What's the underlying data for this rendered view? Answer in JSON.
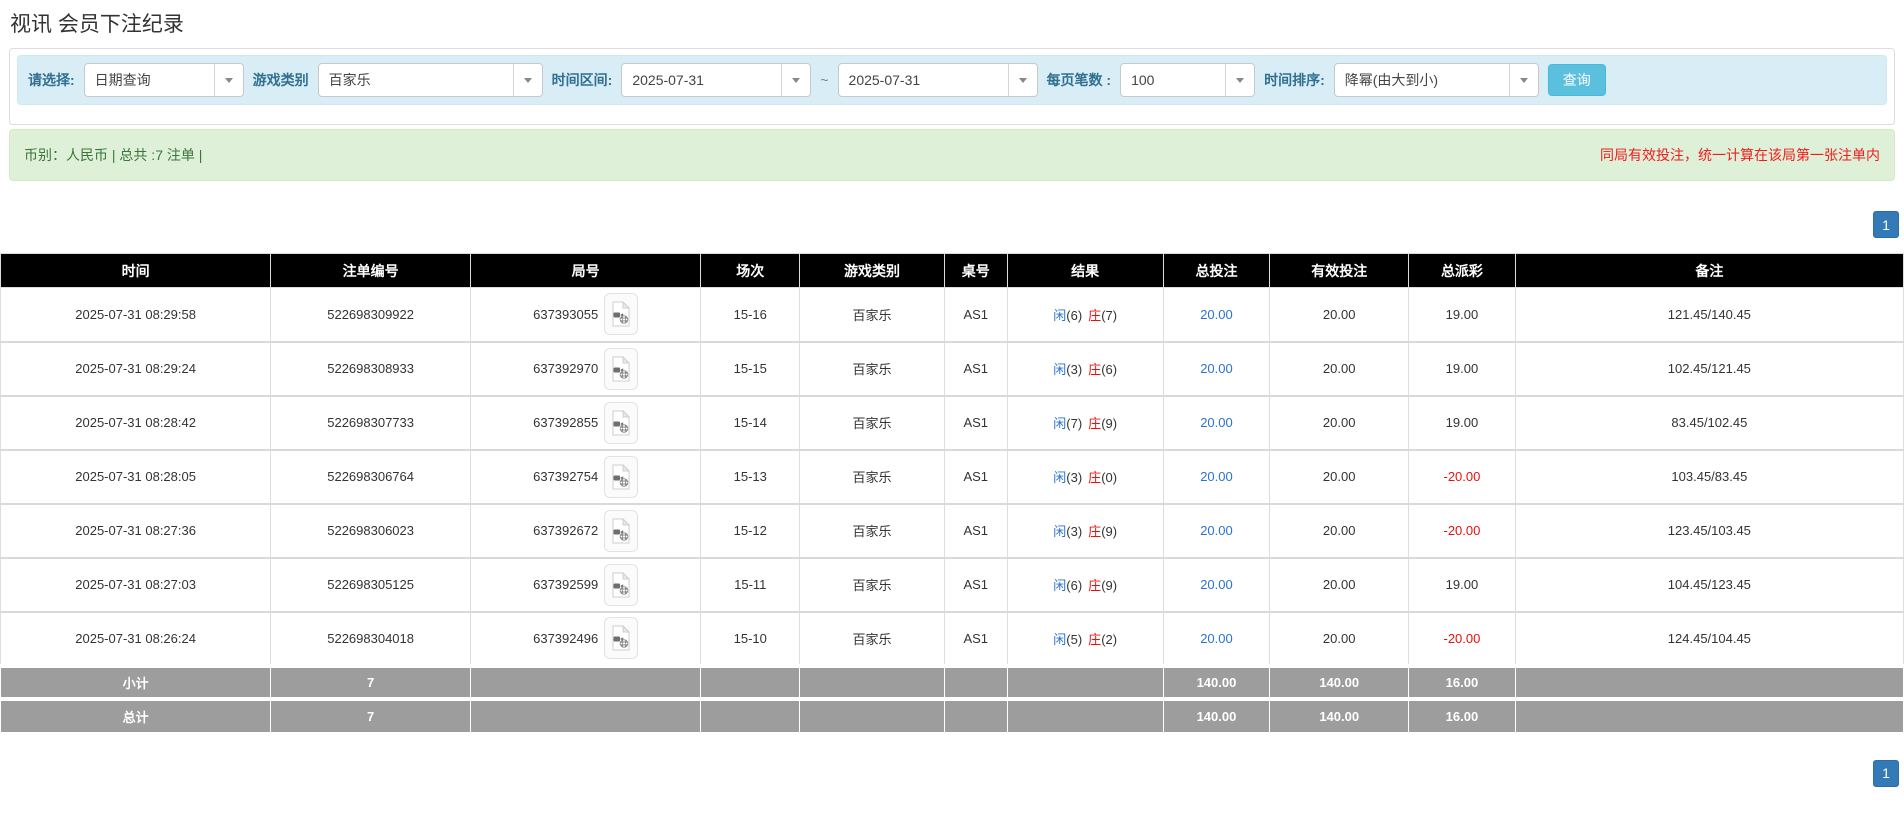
{
  "page_title": "视讯 会员下注纪录",
  "filters": {
    "select_label": "请选择:",
    "select_value": "日期查询",
    "game_type_label": "游戏类别",
    "game_type_value": "百家乐",
    "date_range_label": "时间区间:",
    "date_from": "2025-07-31",
    "date_separator": "~",
    "date_to": "2025-07-31",
    "page_size_label": "每页笔数 :",
    "page_size_value": "100",
    "sort_label": "时间排序:",
    "sort_value": "降幂(由大到小)",
    "search_button": "查询"
  },
  "summary": {
    "left_text": "币别：人民币 | 总共 :7 注单 |",
    "right_note": "同局有效投注，统一计算在该局第一张注单内"
  },
  "pagination": {
    "page": "1"
  },
  "table": {
    "headers": [
      "时间",
      "注单编号",
      "局号",
      "场次",
      "游戏类别",
      "桌号",
      "结果",
      "总投注",
      "有效投注",
      "总派彩",
      "备注"
    ],
    "rows": [
      {
        "time": "2025-07-31 08:29:58",
        "bet_no": "522698309922",
        "round_no": "637393055",
        "session": "15-16",
        "game": "百家乐",
        "table_no": "AS1",
        "r_player": "闲",
        "r_player_n": "(6)",
        "r_banker": "庄",
        "r_banker_n": "(7)",
        "total_bet": "20.00",
        "valid_bet": "20.00",
        "payout": "19.00",
        "note": "121.45/140.45"
      },
      {
        "time": "2025-07-31 08:29:24",
        "bet_no": "522698308933",
        "round_no": "637392970",
        "session": "15-15",
        "game": "百家乐",
        "table_no": "AS1",
        "r_player": "闲",
        "r_player_n": "(3)",
        "r_banker": "庄",
        "r_banker_n": "(6)",
        "total_bet": "20.00",
        "valid_bet": "20.00",
        "payout": "19.00",
        "note": "102.45/121.45"
      },
      {
        "time": "2025-07-31 08:28:42",
        "bet_no": "522698307733",
        "round_no": "637392855",
        "session": "15-14",
        "game": "百家乐",
        "table_no": "AS1",
        "r_player": "闲",
        "r_player_n": "(7)",
        "r_banker": "庄",
        "r_banker_n": "(9)",
        "total_bet": "20.00",
        "valid_bet": "20.00",
        "payout": "19.00",
        "note": "83.45/102.45"
      },
      {
        "time": "2025-07-31 08:28:05",
        "bet_no": "522698306764",
        "round_no": "637392754",
        "session": "15-13",
        "game": "百家乐",
        "table_no": "AS1",
        "r_player": "闲",
        "r_player_n": "(3)",
        "r_banker": "庄",
        "r_banker_n": "(0)",
        "total_bet": "20.00",
        "valid_bet": "20.00",
        "payout": "-20.00",
        "note": "103.45/83.45"
      },
      {
        "time": "2025-07-31 08:27:36",
        "bet_no": "522698306023",
        "round_no": "637392672",
        "session": "15-12",
        "game": "百家乐",
        "table_no": "AS1",
        "r_player": "闲",
        "r_player_n": "(3)",
        "r_banker": "庄",
        "r_banker_n": "(9)",
        "total_bet": "20.00",
        "valid_bet": "20.00",
        "payout": "-20.00",
        "note": "123.45/103.45"
      },
      {
        "time": "2025-07-31 08:27:03",
        "bet_no": "522698305125",
        "round_no": "637392599",
        "session": "15-11",
        "game": "百家乐",
        "table_no": "AS1",
        "r_player": "闲",
        "r_player_n": "(6)",
        "r_banker": "庄",
        "r_banker_n": "(9)",
        "total_bet": "20.00",
        "valid_bet": "20.00",
        "payout": "19.00",
        "note": "104.45/123.45"
      },
      {
        "time": "2025-07-31 08:26:24",
        "bet_no": "522698304018",
        "round_no": "637392496",
        "session": "15-10",
        "game": "百家乐",
        "table_no": "AS1",
        "r_player": "闲",
        "r_player_n": "(5)",
        "r_banker": "庄",
        "r_banker_n": "(2)",
        "total_bet": "20.00",
        "valid_bet": "20.00",
        "payout": "-20.00",
        "note": "124.45/104.45"
      }
    ],
    "subtotal": {
      "label": "小计",
      "count": "7",
      "total_bet": "140.00",
      "valid_bet": "140.00",
      "payout": "16.00"
    },
    "total": {
      "label": "总计",
      "count": "7",
      "total_bet": "140.00",
      "valid_bet": "140.00",
      "payout": "16.00"
    }
  },
  "icons": {
    "select_arrow": "chevron-down-icon",
    "round_video": "video-file-icon"
  },
  "colors": {
    "link-blue": "#2a72d5",
    "result-red": "#e8100c",
    "note-red": "#f21c1c",
    "header-bg": "#000000",
    "subtotal-bg": "#9d9d9d",
    "summary-bg": "#dff0d8",
    "summary-text": "#3c763d",
    "filter-bg": "#d9edf7",
    "filter-label": "#31708f",
    "search-btn-bg": "#5bc0de",
    "pagination-bg": "#337ab7",
    "border": "#dddddd"
  }
}
